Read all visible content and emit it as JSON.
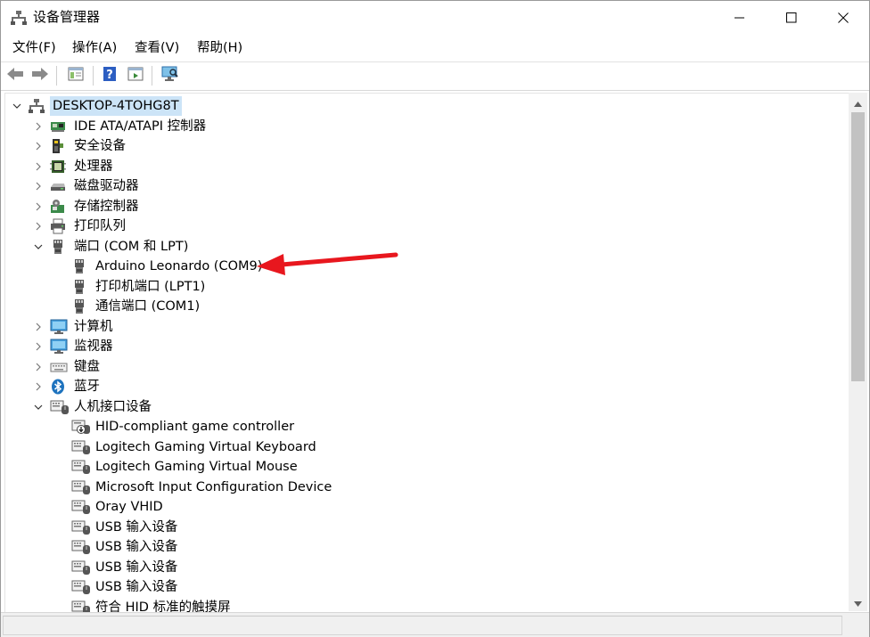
{
  "window": {
    "title": "设备管理器",
    "icons": {
      "app": "device-manager-icon",
      "minimize": "minimize-icon",
      "maximize": "maximize-icon",
      "close": "close-icon"
    }
  },
  "menu": [
    "文件(F)",
    "操作(A)",
    "查看(V)",
    "帮助(H)"
  ],
  "toolbar": [
    "back-icon",
    "forward-icon",
    "properties-icon",
    "help-icon",
    "update-driver-icon",
    "scan-hardware-icon"
  ],
  "tree": {
    "root": {
      "label": "DESKTOP-4TOHG8T",
      "icon": "computer-icon",
      "expanded": true,
      "selected": true
    },
    "categories": [
      {
        "label": "IDE ATA/ATAPI 控制器",
        "icon": "ide-controller-icon",
        "expanded": false,
        "children": []
      },
      {
        "label": "安全设备",
        "icon": "security-device-icon",
        "expanded": false,
        "children": []
      },
      {
        "label": "处理器",
        "icon": "processor-icon",
        "expanded": false,
        "children": []
      },
      {
        "label": "磁盘驱动器",
        "icon": "disk-drive-icon",
        "expanded": false,
        "children": []
      },
      {
        "label": "存储控制器",
        "icon": "storage-controller-icon",
        "expanded": false,
        "children": []
      },
      {
        "label": "打印队列",
        "icon": "printer-icon",
        "expanded": false,
        "children": []
      },
      {
        "label": "端口 (COM 和 LPT)",
        "icon": "port-icon",
        "expanded": true,
        "children": [
          {
            "label": "Arduino Leonardo (COM9)",
            "icon": "port-icon"
          },
          {
            "label": "打印机端口 (LPT1)",
            "icon": "port-icon"
          },
          {
            "label": "通信端口 (COM1)",
            "icon": "port-icon"
          }
        ]
      },
      {
        "label": "计算机",
        "icon": "monitor-icon",
        "expanded": false,
        "children": []
      },
      {
        "label": "监视器",
        "icon": "monitor-icon",
        "expanded": false,
        "children": []
      },
      {
        "label": "键盘",
        "icon": "keyboard-icon",
        "expanded": false,
        "children": []
      },
      {
        "label": "蓝牙",
        "icon": "bluetooth-icon",
        "expanded": false,
        "children": []
      },
      {
        "label": "人机接口设备",
        "icon": "hid-icon",
        "expanded": true,
        "children": [
          {
            "label": "HID-compliant game controller",
            "icon": "hid-download-icon"
          },
          {
            "label": "Logitech Gaming Virtual Keyboard",
            "icon": "hid-icon"
          },
          {
            "label": "Logitech Gaming Virtual Mouse",
            "icon": "hid-icon"
          },
          {
            "label": "Microsoft Input Configuration Device",
            "icon": "hid-icon"
          },
          {
            "label": "Oray VHID",
            "icon": "hid-icon"
          },
          {
            "label": "USB 输入设备",
            "icon": "hid-icon"
          },
          {
            "label": "USB 输入设备",
            "icon": "hid-icon"
          },
          {
            "label": "USB 输入设备",
            "icon": "hid-icon"
          },
          {
            "label": "USB 输入设备",
            "icon": "hid-icon"
          },
          {
            "label": "符合 HID 标准的触摸屏",
            "icon": "hid-icon"
          }
        ]
      }
    ]
  },
  "annotation": {
    "type": "red-arrow",
    "target": "Arduino Leonardo (COM9)",
    "color": "#e8171e"
  },
  "colors": {
    "selection": "#cce4f7",
    "arrow": "#e8171e",
    "icon_blue": "#1e73be"
  }
}
